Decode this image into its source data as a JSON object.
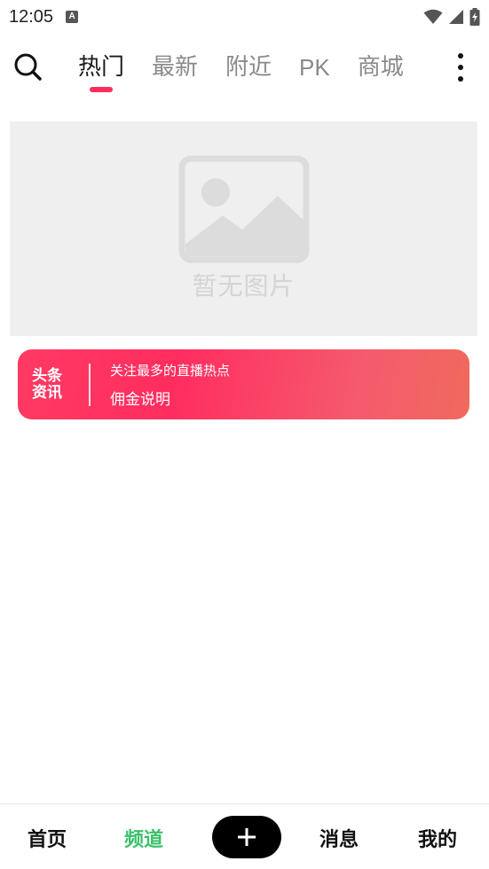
{
  "status_bar": {
    "time": "12:05",
    "notification_icon": "a-icon",
    "icons": [
      "wifi-icon",
      "signal-icon",
      "battery-charging-icon"
    ]
  },
  "top_nav": {
    "search_icon": "search-icon",
    "tabs": [
      {
        "label": "热门",
        "active": true
      },
      {
        "label": "最新",
        "active": false
      },
      {
        "label": "附近",
        "active": false
      },
      {
        "label": "PK",
        "active": false
      },
      {
        "label": "商城",
        "active": false
      }
    ],
    "more_icon": "more-vertical-icon",
    "active_indicator_color": "#ff2d5a"
  },
  "banner": {
    "placeholder_icon": "image-placeholder-icon",
    "placeholder_text": "暂无图片"
  },
  "news_card": {
    "logo_line1": "头条",
    "logo_line2": "资讯",
    "line1": "关注最多的直播热点",
    "line2": "佣金说明",
    "gradient_start": "#ff3a63",
    "gradient_end": "#f06a5c"
  },
  "bottom_nav": {
    "items": [
      {
        "label": "首页",
        "active": false
      },
      {
        "label": "频道",
        "active": true
      },
      {
        "label": "消息",
        "active": false
      },
      {
        "label": "我的",
        "active": false
      }
    ],
    "add_icon": "plus-icon",
    "active_color": "#3cc06a"
  }
}
